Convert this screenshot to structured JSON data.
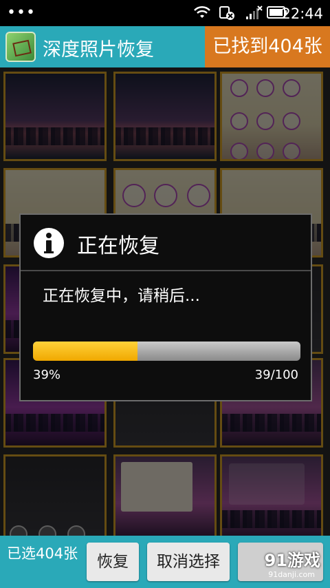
{
  "status_bar": {
    "time": "22:44"
  },
  "app_bar": {
    "title": "深度照片恢复",
    "found_text": "已找到404张"
  },
  "dialog": {
    "title": "正在恢复",
    "message": "正在恢复中，请稍后...",
    "progress_fraction": 0.39,
    "percent_text": "39%",
    "count_text": "39/100"
  },
  "bottom_bar": {
    "selected_text": "已选404张",
    "recover_label": "恢复",
    "cancel_select_label": "取消选择"
  },
  "watermark": {
    "logo": "91游戏",
    "url": "91danji.com"
  },
  "colors": {
    "app_bar": "#2aa9b8",
    "found_badge": "#d8781f",
    "tile_border": "#e0a829",
    "progress_fill": "#f0a800"
  }
}
